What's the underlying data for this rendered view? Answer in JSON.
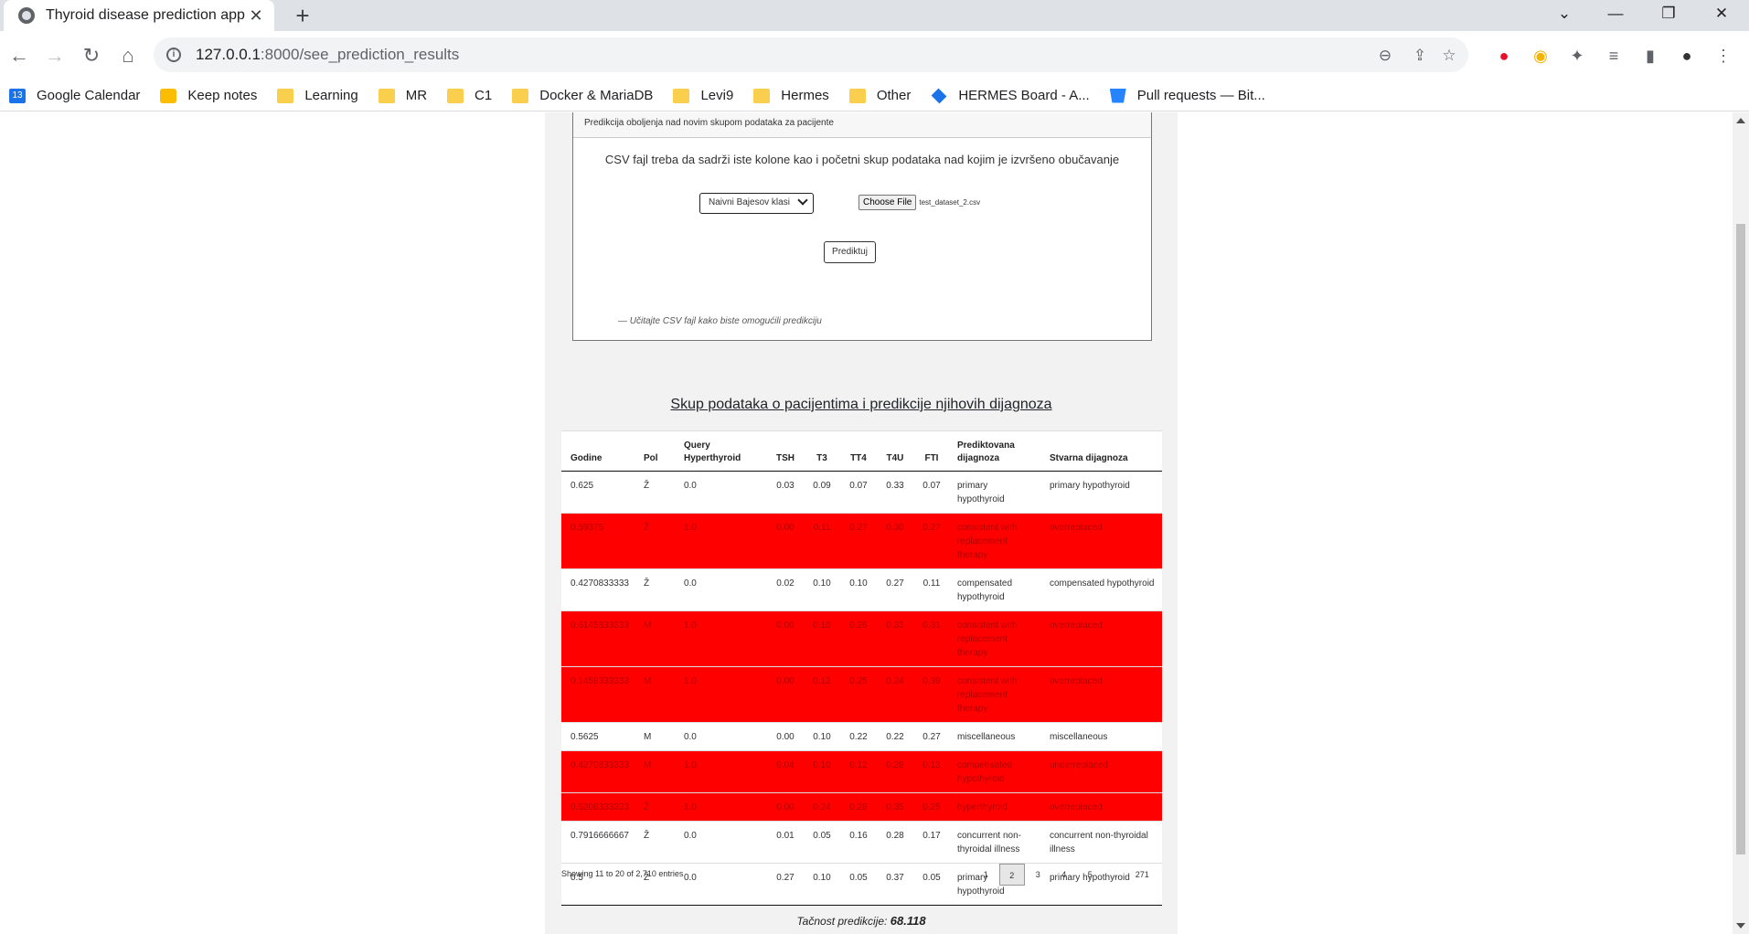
{
  "browser": {
    "tab_title": "Thyroid disease prediction app",
    "url_host": "127.0.0.1",
    "url_rest": ":8000/see_prediction_results",
    "bookmarks": [
      {
        "label": "Google Calendar",
        "icon": "calendar-icon"
      },
      {
        "label": "Keep notes",
        "icon": "keep-icon"
      },
      {
        "label": "Learning",
        "icon": "folder-icon"
      },
      {
        "label": "MR",
        "icon": "folder-icon"
      },
      {
        "label": "C1",
        "icon": "folder-icon"
      },
      {
        "label": "Docker & MariaDB",
        "icon": "folder-icon"
      },
      {
        "label": "Levi9",
        "icon": "folder-icon"
      },
      {
        "label": "Hermes",
        "icon": "folder-icon"
      },
      {
        "label": "Other",
        "icon": "folder-icon"
      },
      {
        "label": "HERMES Board - A...",
        "icon": "hermes-icon"
      },
      {
        "label": "Pull requests — Bit...",
        "icon": "bitbucket-icon"
      }
    ],
    "calendar_day": "13"
  },
  "prediction_card": {
    "header": "Predikcija oboljenja nad novim skupom podataka za pacijente",
    "description": "CSV fajl treba da sadrži iste kolone kao i početni skup podataka nad kojim je izvršeno obučavanje",
    "model_select": "Naivni Bajesov klasi",
    "file_button": "Choose File",
    "file_name": "test_dataset_2.csv",
    "predict_button": "Prediktuj",
    "hint": "— Učitajte CSV fajl kako biste omogućili predikciju"
  },
  "results": {
    "title": "Skup podataka o pacijentima i predikcije njihovih dijagnoza",
    "columns": [
      "Godine",
      "Pol",
      "Query Hyperthyroid",
      "TSH",
      "T3",
      "TT4",
      "T4U",
      "FTI",
      "Prediktovana dijagnoza",
      "Stvarna dijagnoza"
    ],
    "rows": [
      {
        "cells": [
          "0.625",
          "Ž",
          "0.0",
          "0.03",
          "0.09",
          "0.07",
          "0.33",
          "0.07",
          "primary hypothyroid",
          "primary hypothyroid"
        ],
        "mismatch": false
      },
      {
        "cells": [
          "0.59375",
          "Ž",
          "1.0",
          "0.00",
          "0.11",
          "0.27",
          "0.30",
          "0.27",
          "consistent with replacement therapy",
          "overreplaced"
        ],
        "mismatch": true
      },
      {
        "cells": [
          "0.4270833333",
          "Ž",
          "0.0",
          "0.02",
          "0.10",
          "0.10",
          "0.27",
          "0.11",
          "compensated hypothyroid",
          "compensated hypothyroid"
        ],
        "mismatch": false
      },
      {
        "cells": [
          "0.6145833333",
          "M",
          "1.0",
          "0.00",
          "0.10",
          "0.26",
          "0.33",
          "0.31",
          "consistent with replacement therapy",
          "overreplaced"
        ],
        "mismatch": true
      },
      {
        "cells": [
          "0.1458333333",
          "M",
          "1.0",
          "0.00",
          "0.12",
          "0.25",
          "0.24",
          "0.39",
          "consistent with replacement therapy",
          "overreplaced"
        ],
        "mismatch": true
      },
      {
        "cells": [
          "0.5625",
          "M",
          "0.0",
          "0.00",
          "0.10",
          "0.22",
          "0.22",
          "0.27",
          "miscellaneous",
          "miscellaneous"
        ],
        "mismatch": false
      },
      {
        "cells": [
          "0.4270833333",
          "M",
          "1.0",
          "0.04",
          "0.10",
          "0.12",
          "0.28",
          "0.13",
          "compensated hypothyroid",
          "underreplaced"
        ],
        "mismatch": true
      },
      {
        "cells": [
          "0.5208333333",
          "Ž",
          "1.0",
          "0.00",
          "0.24",
          "0.28",
          "0.35",
          "0.25",
          "hyperthyroid",
          "overreplaced"
        ],
        "mismatch": true
      },
      {
        "cells": [
          "0.7916666667",
          "Ž",
          "0.0",
          "0.01",
          "0.05",
          "0.16",
          "0.28",
          "0.17",
          "concurrent non-thyroidal illness",
          "concurrent non-thyroidal illness"
        ],
        "mismatch": false
      },
      {
        "cells": [
          "0.5",
          "Ž",
          "0.0",
          "0.27",
          "0.10",
          "0.05",
          "0.37",
          "0.05",
          "primary hypothyroid",
          "primary hypothyroid"
        ],
        "mismatch": false
      }
    ],
    "info": "Showing 11 to 20 of 2,710 entries",
    "pages": [
      "1",
      "2",
      "3",
      "4",
      "5",
      "…",
      "271"
    ],
    "active_page": "2",
    "accuracy_label": "Tačnost predikcije:",
    "accuracy_value": "68.118",
    "mismatch_color": "#ff0000"
  }
}
